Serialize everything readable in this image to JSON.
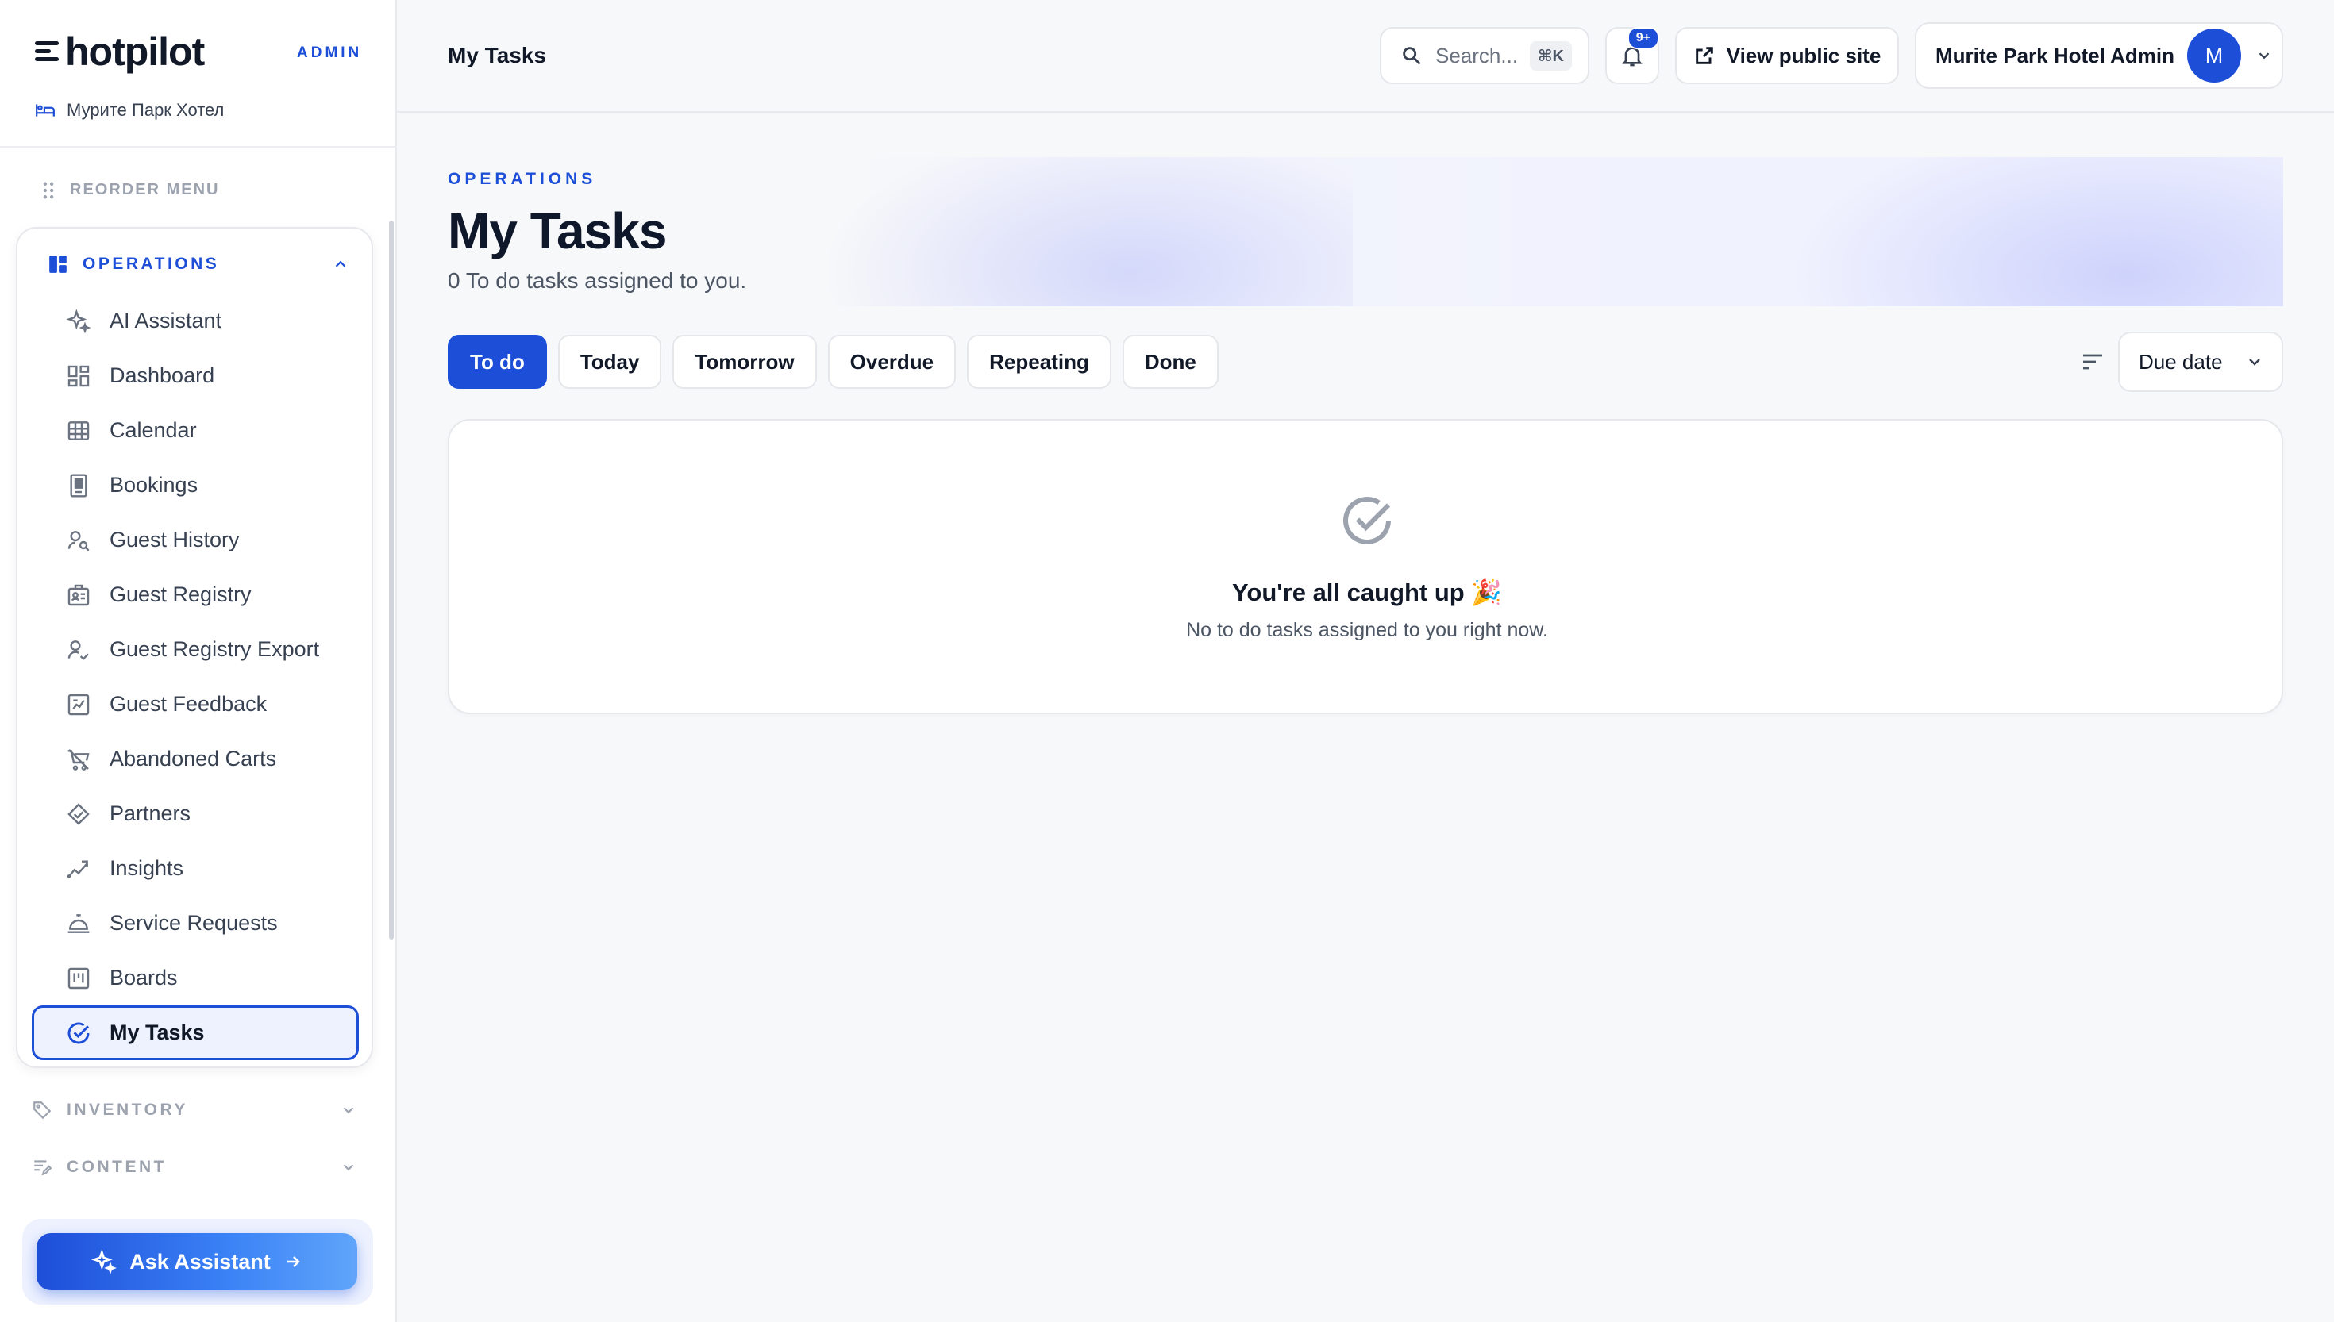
{
  "brand": {
    "name": "hotpilot",
    "role_tag": "ADMIN",
    "hotel_name": "Мурите Парк Хотел"
  },
  "sidebar": {
    "reorder_label": "REORDER MENU",
    "operations": {
      "label": "OPERATIONS",
      "items": [
        {
          "label": "AI Assistant",
          "icon": "sparkles-icon"
        },
        {
          "label": "Dashboard",
          "icon": "dashboard-icon"
        },
        {
          "label": "Calendar",
          "icon": "grid-calendar-icon"
        },
        {
          "label": "Bookings",
          "icon": "booking-icon"
        },
        {
          "label": "Guest History",
          "icon": "user-search-icon"
        },
        {
          "label": "Guest Registry",
          "icon": "id-card-icon"
        },
        {
          "label": "Guest Registry Export",
          "icon": "user-check-icon"
        },
        {
          "label": "Guest Feedback",
          "icon": "feedback-icon"
        },
        {
          "label": "Abandoned Carts",
          "icon": "cart-off-icon"
        },
        {
          "label": "Partners",
          "icon": "handshake-icon"
        },
        {
          "label": "Insights",
          "icon": "chart-line-icon"
        },
        {
          "label": "Service Requests",
          "icon": "service-bell-icon"
        },
        {
          "label": "Boards",
          "icon": "kanban-icon"
        },
        {
          "label": "My Tasks",
          "icon": "check-circle-icon",
          "active": true
        }
      ]
    },
    "inventory_label": "INVENTORY",
    "content_label": "CONTENT",
    "ask_label": "Ask Assistant"
  },
  "topbar": {
    "title": "My Tasks",
    "search_placeholder": "Search...",
    "search_shortcut": "⌘K",
    "notification_badge": "9+",
    "view_site_label": "View public site",
    "account_name": "Murite Park Hotel Admin",
    "avatar_initial": "M"
  },
  "main": {
    "kicker": "OPERATIONS",
    "title": "My Tasks",
    "subtitle": "0 To do tasks assigned to you.",
    "tabs": [
      "To do",
      "Today",
      "Tomorrow",
      "Overdue",
      "Repeating",
      "Done"
    ],
    "active_tab": "To do",
    "sort_value": "Due date",
    "empty_title": "You're all caught up 🎉",
    "empty_message": "No to do tasks assigned to you right now."
  },
  "colors": {
    "accent": "#1d4ed8",
    "background": "#f7f8fa",
    "text": "#111827",
    "muted": "#4b5563"
  }
}
